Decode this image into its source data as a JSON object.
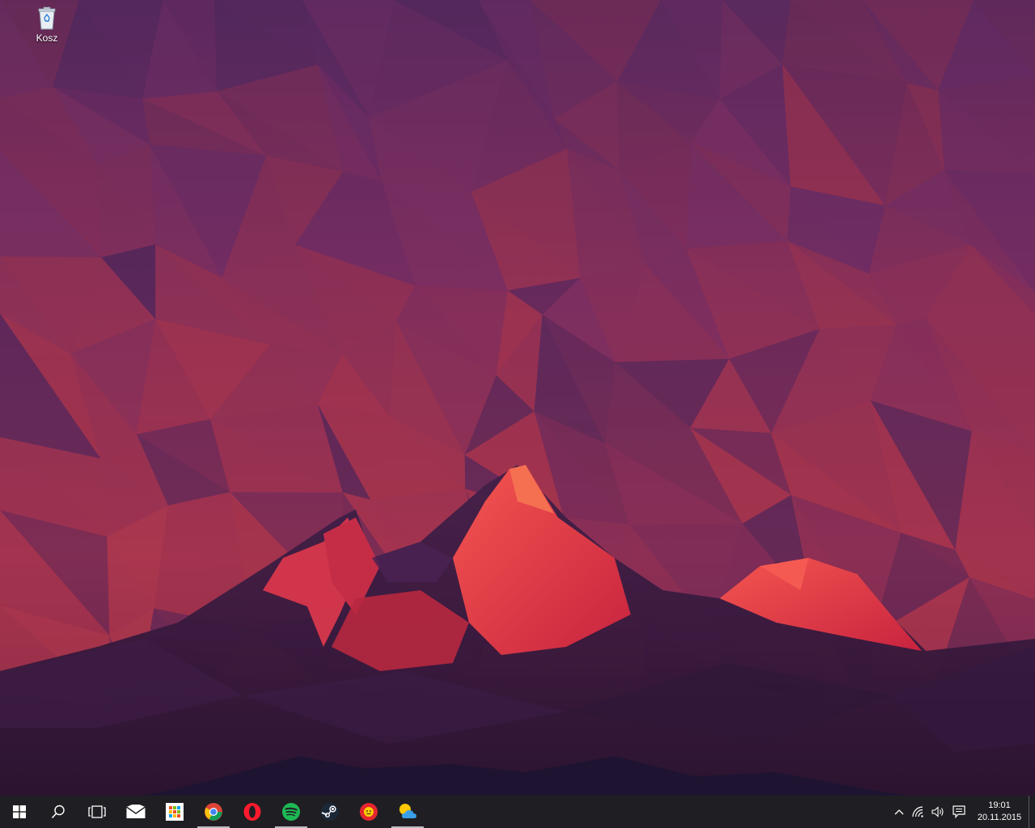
{
  "desktop": {
    "icons": [
      {
        "label": "Kosz",
        "icon": "recycle-bin-icon"
      }
    ],
    "wallpaper_colors": {
      "sky_top": "#4e2757",
      "sky_mid": "#7a2e58",
      "sky_low": "#9a2f4a",
      "ridge": "#5a2a5a",
      "peak": "#e8354a",
      "peak_highlight": "#f4564f",
      "foreground": "#3a1d40",
      "horizon": "#1e1431"
    }
  },
  "taskbar": {
    "background": "#1f1f23",
    "buttons": [
      {
        "name": "start-button",
        "icon": "windows-logo-icon",
        "running": false
      },
      {
        "name": "search-button",
        "icon": "search-icon",
        "running": false
      },
      {
        "name": "task-view-button",
        "icon": "task-view-icon",
        "running": false
      },
      {
        "name": "mail-app-button",
        "icon": "mail-icon",
        "running": false
      },
      {
        "name": "store-app-button",
        "icon": "store-icon",
        "running": false
      },
      {
        "name": "chrome-app-button",
        "icon": "chrome-icon",
        "running": true
      },
      {
        "name": "opera-app-button",
        "icon": "opera-icon",
        "running": false
      },
      {
        "name": "spotify-app-button",
        "icon": "spotify-icon",
        "running": true
      },
      {
        "name": "steam-app-button",
        "icon": "steam-icon",
        "running": false
      },
      {
        "name": "sunny-app-button",
        "icon": "sun-face-icon",
        "running": false
      },
      {
        "name": "weather-app-button",
        "icon": "weather-icon",
        "running": true
      }
    ],
    "tray": {
      "icons": [
        "chevron-up-icon",
        "wifi-icon",
        "volume-icon",
        "action-center-icon"
      ],
      "time": "19:01",
      "date": "20.11.2015"
    }
  }
}
